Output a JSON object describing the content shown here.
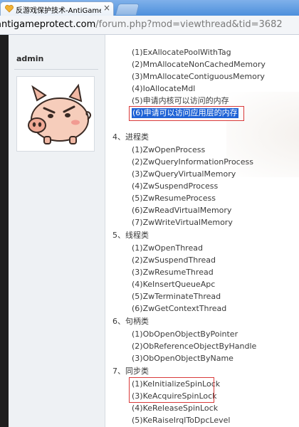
{
  "browser": {
    "tab_title": "反游戏保护技术-AntiGame",
    "tab_close": "×",
    "url_host": "antigameprotect.com",
    "url_path": "/forum.php?mod=viewthread&tid=3682"
  },
  "sidebar": {
    "username": "admin"
  },
  "post": {
    "memory_items": [
      "(1)ExAllocatePoolWithTag",
      "(2)MmAllocateNonCachedMemory",
      "(3)MmAllocateContiguousMemory",
      "(4)IoAllocateMdl",
      "(5)申请内核可以访问的内存",
      "(6)申请可以访问应用层的内存"
    ],
    "process": {
      "heading": "4、进程类",
      "items": [
        "(1)ZwOpenProcess",
        "(2)ZwQueryInformationProcess",
        "(3)ZwQueryVirtualMemory",
        "(4)ZwSuspendProcess",
        "(5)ZwResumeProcess",
        "(6)ZwReadVirtualMemory",
        "(7)ZwWriteVirtualMemory"
      ]
    },
    "thread": {
      "heading": "5、线程类",
      "items": [
        "(1)ZwOpenThread",
        "(2)ZwSuspendThread",
        "(3)ZwResumeThread",
        "(4)KeInsertQueueApc",
        "(5)ZwTerminateThread",
        "(6)ZwGetContextThread"
      ]
    },
    "handle": {
      "heading": "6、句柄类",
      "items": [
        "(1)ObOpenObjectByPointer",
        "(2)ObReferenceObjectByHandle",
        "(3)ObOpenObjectByName"
      ]
    },
    "sync": {
      "heading": "7、同步类",
      "items": [
        "(1)KeInitializeSpinLock",
        "(3)KeAcquireSpinLock",
        "(4)KeReleaseSpinLock",
        "(5)KeRaiseIrqlToDpcLevel"
      ]
    }
  },
  "colors": {
    "selection": "#1f63d6",
    "highlight_box": "#d93a3a",
    "text": "#3a3a3a"
  }
}
